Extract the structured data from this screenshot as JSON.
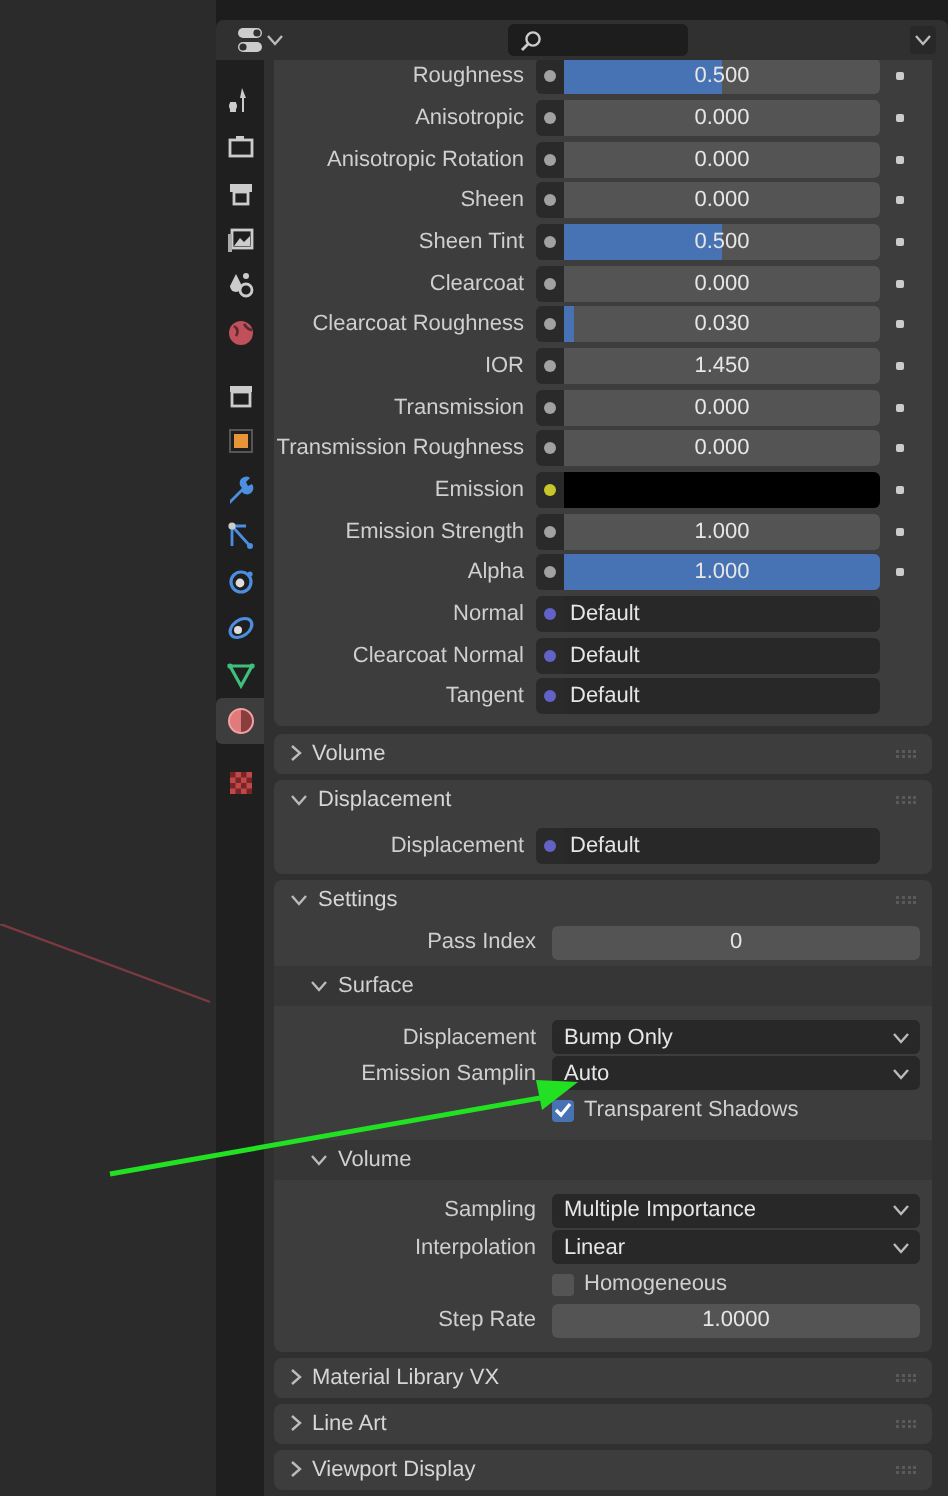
{
  "sidebar_tabs": [
    {
      "selected": false
    },
    {
      "selected": false
    },
    {
      "selected": false
    },
    {
      "selected": false
    },
    {
      "selected": false
    },
    {
      "selected": false
    },
    {
      "selected": false
    },
    {
      "selected": false
    },
    {
      "selected": false
    },
    {
      "selected": false
    },
    {
      "selected": false
    },
    {
      "selected": false
    },
    {
      "selected": false
    },
    {
      "selected": true
    },
    {
      "selected": false
    }
  ],
  "inputs": [
    {
      "label": "Roughness",
      "kind": "slider",
      "color": "#a1a1a1",
      "value": "0.500",
      "level": 0.5
    },
    {
      "label": "Anisotropic",
      "kind": "slider",
      "color": "#a1a1a1",
      "value": "0.000",
      "level": 0
    },
    {
      "label": "Anisotropic Rotation",
      "kind": "slider",
      "color": "#a1a1a1",
      "value": "0.000",
      "level": 0
    },
    {
      "label": "Sheen",
      "kind": "slider",
      "color": "#a1a1a1",
      "value": "0.000",
      "level": 0
    },
    {
      "label": "Sheen Tint",
      "kind": "slider",
      "color": "#a1a1a1",
      "value": "0.500",
      "level": 0.5
    },
    {
      "label": "Clearcoat",
      "kind": "slider",
      "color": "#a1a1a1",
      "value": "0.000",
      "level": 0
    },
    {
      "label": "Clearcoat Roughness",
      "kind": "slider",
      "color": "#a1a1a1",
      "value": "0.030",
      "level": 0.03
    },
    {
      "label": "IOR",
      "kind": "number",
      "color": "#a1a1a1",
      "value": "1.450"
    },
    {
      "label": "Transmission",
      "kind": "slider",
      "color": "#a1a1a1",
      "value": "0.000",
      "level": 0
    },
    {
      "label": "Transmission Roughness",
      "kind": "slider",
      "color": "#a1a1a1",
      "value": "0.000",
      "level": 0
    },
    {
      "label": "Emission",
      "kind": "color",
      "color": "#c7c729",
      "swatch": {
        "color": "#000000"
      }
    },
    {
      "label": "Emission Strength",
      "kind": "number",
      "color": "#a1a1a1",
      "value": "1.000"
    },
    {
      "label": "Alpha",
      "kind": "slider",
      "color": "#a1a1a1",
      "value": "1.000",
      "level": 1
    },
    {
      "label": "Normal",
      "kind": "link",
      "color": "#6363c7",
      "value": "Default"
    },
    {
      "label": "Clearcoat Normal",
      "kind": "link",
      "color": "#6363c7",
      "value": "Default"
    },
    {
      "label": "Tangent",
      "kind": "link",
      "color": "#6363c7",
      "value": "Default"
    }
  ],
  "panels": [
    {
      "title": "Volume",
      "expanded": false
    },
    {
      "title": "Displacement",
      "expanded": true,
      "inputs": [
        {
          "label": "Displacement",
          "kind": "link",
          "color": "#6363c7",
          "value": "Default"
        }
      ]
    },
    {
      "title": "Settings",
      "expanded": true,
      "rows": [
        {
          "kind": "number",
          "label": "Pass Index",
          "value": "0"
        }
      ],
      "subpanels": [
        {
          "title": "Surface",
          "expanded": true,
          "rows": [
            {
              "kind": "dropdown",
              "label": "Displacement",
              "value": "Bump Only"
            },
            {
              "kind": "dropdown",
              "label": "Emission Samplin",
              "value": "Auto"
            },
            {
              "kind": "checkbox",
              "label": "Transparent Shadows",
              "checked": true
            }
          ]
        },
        {
          "title": "Volume",
          "expanded": true,
          "rows": [
            {
              "kind": "dropdown",
              "label": "Sampling",
              "value": "Multiple Importance"
            },
            {
              "kind": "dropdown",
              "label": "Interpolation",
              "value": "Linear"
            },
            {
              "kind": "checkbox",
              "label": "Homogeneous",
              "checked": false
            },
            {
              "kind": "number",
              "label": "Step Rate",
              "value": "1.0000"
            }
          ]
        }
      ]
    },
    {
      "title": "Material Library VX",
      "expanded": false
    },
    {
      "title": "Line Art",
      "expanded": false
    },
    {
      "title": "Viewport Display",
      "expanded": false
    }
  ]
}
